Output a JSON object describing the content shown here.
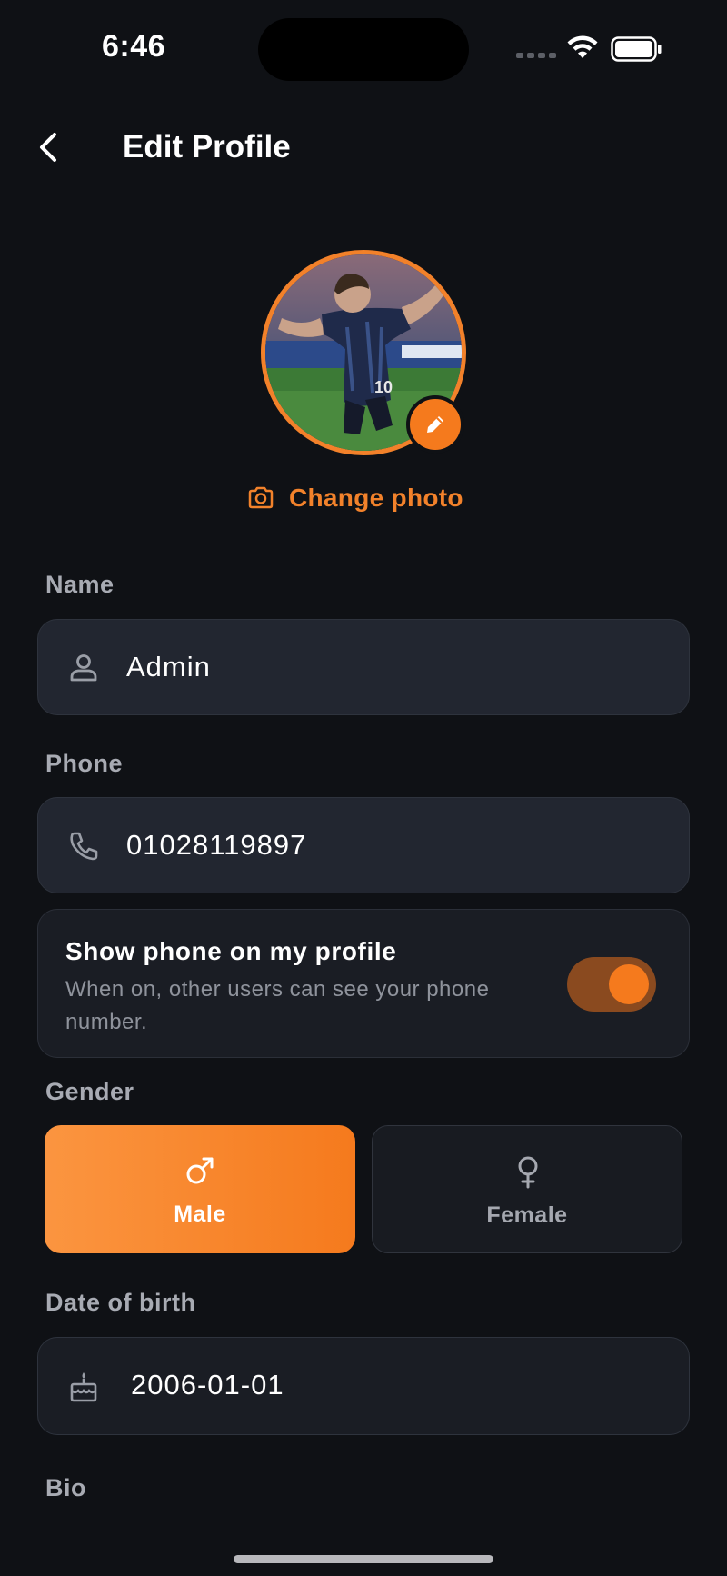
{
  "status_bar": {
    "time": "6:46"
  },
  "header": {
    "title": "Edit Profile"
  },
  "avatar": {
    "change_photo_label": "Change photo"
  },
  "fields": {
    "name": {
      "label": "Name",
      "value": "Admin"
    },
    "phone": {
      "label": "Phone",
      "value": "01028119897"
    },
    "date_of_birth": {
      "label": "Date of birth",
      "value": "2006-01-01"
    },
    "bio": {
      "label": "Bio"
    }
  },
  "phone_visibility": {
    "title": "Show phone on my profile",
    "description": "When on, other users can see your phone number.",
    "enabled": true
  },
  "gender": {
    "label": "Gender",
    "options": [
      {
        "label": "Male",
        "icon": "male-icon",
        "selected": true
      },
      {
        "label": "Female",
        "icon": "female-icon",
        "selected": false
      }
    ]
  },
  "colors": {
    "accent": "#F57A1D",
    "background": "#0F1115",
    "field_background": "#222630"
  }
}
